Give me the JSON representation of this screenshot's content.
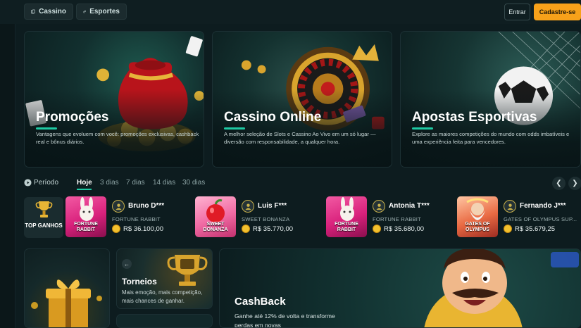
{
  "nav": {
    "cassino": "Cassino",
    "esportes": "Esportes",
    "entrar": "Entrar",
    "cadastre": "Cadastre-se"
  },
  "colors": {
    "accent": "#1ec9a3",
    "cta": "#f7a11a",
    "background": "#0d1c1f"
  },
  "hero": [
    {
      "title": "Promoções",
      "description": "Vantagens que evoluem com você: promoções exclusivas, cashback real e bônus diários.",
      "icon": "money-bag-icon"
    },
    {
      "title": "Cassino Online",
      "description": "A melhor seleção de Slots e Cassino Ao Vivo em um só lugar — diversão com responsabilidade, a qualquer hora.",
      "icon": "roulette-icon"
    },
    {
      "title": "Apostas Esportivas",
      "description": "Explore as maiores competições do mundo com odds imbatíveis e uma experiência feita para vencedores.",
      "icon": "soccer-ball-icon"
    }
  ],
  "period": {
    "label": "Período",
    "tabs": [
      "Hoje",
      "3 dias",
      "7 dias",
      "14 dias",
      "30 dias"
    ],
    "active": "Hoje"
  },
  "top_ganhos": {
    "label": "TOP GANHOS"
  },
  "winners": [
    {
      "name": "Bruno D***",
      "game": "FORTUNE RABBIT",
      "amount": "R$ 36.100,00",
      "thumb_label": "FORTUNE RABBIT"
    },
    {
      "name": "Luis F***",
      "game": "SWEET BONANZA",
      "amount": "R$ 35.770,00",
      "thumb_label": "SWEET BONANZA"
    },
    {
      "name": "Antonia T***",
      "game": "FORTUNE RABBIT",
      "amount": "R$ 35.680,00",
      "thumb_label": "FORTUNE RABBIT"
    },
    {
      "name": "Fernando J***",
      "game": "GATES OF OLYMPUS SUP...",
      "amount": "R$ 35.679,25",
      "thumb_label": "GATES OF OLYMPUS"
    }
  ],
  "promos": {
    "torneios_title": "Torneios",
    "torneios_desc": "Mais emoção, mais competição, mais chances de ganhar.",
    "cashback_title": "CashBack",
    "cashback_desc": "Ganhe até 12% de volta e transforme perdas em novas"
  }
}
